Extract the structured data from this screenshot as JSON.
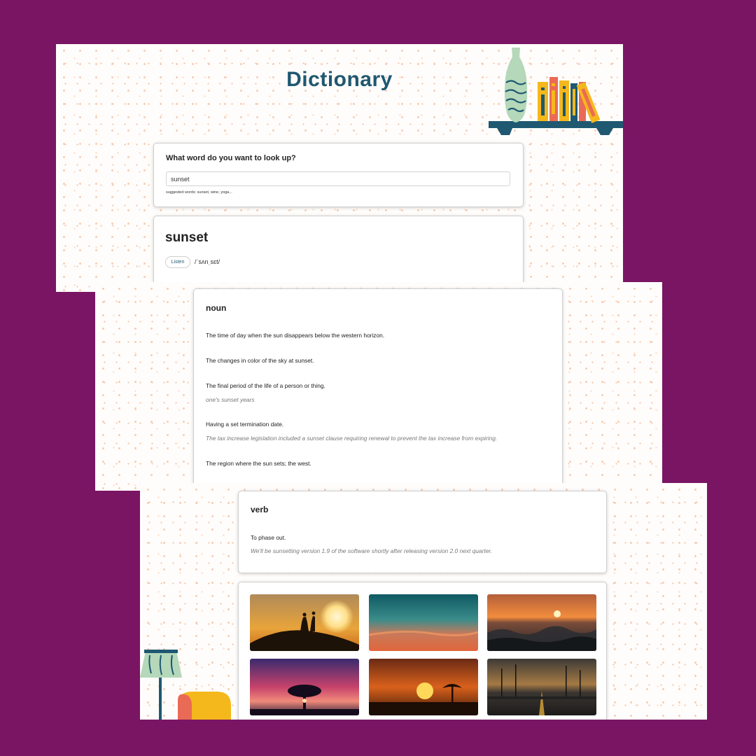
{
  "app": {
    "title": "Dictionary"
  },
  "search": {
    "label": "What word do you want to look up?",
    "value": "sunset",
    "suggestions": "suggested words: sunset, wine, yoga..."
  },
  "word": {
    "text": "sunset",
    "listen_label": "Listen",
    "phonetic": "/ˈsʌnˌsɛt/"
  },
  "meanings": [
    {
      "part_of_speech": "noun",
      "definitions": [
        {
          "definition": "The time of day when the sun disappears below the western horizon.",
          "example": ""
        },
        {
          "definition": "The changes in color of the sky at sunset.",
          "example": ""
        },
        {
          "definition": "The final period of the life of a person or thing.",
          "example": "one's sunset years"
        },
        {
          "definition": "Having a set termination date.",
          "example": "The tax increase legislation included a sunset clause requiring renewal to prevent the tax increase from expiring."
        },
        {
          "definition": "The region where the sun sets; the west.",
          "example": ""
        }
      ]
    },
    {
      "part_of_speech": "verb",
      "definitions": [
        {
          "definition": "To phase out.",
          "example": "We'll be sunsetting version 1.9 of the software shortly after releasing version 2.0 next quarter."
        }
      ]
    }
  ],
  "photos": [
    {
      "subject": "couple silhouette on hill at sunset"
    },
    {
      "subject": "teal and orange sky"
    },
    {
      "subject": "ocean waves at sunset"
    },
    {
      "subject": "lone tree under purple sky"
    },
    {
      "subject": "sun over savanna with tree"
    },
    {
      "subject": "palm tree lined road at dusk"
    }
  ],
  "colors": {
    "outer_background": "#7a1564",
    "title": "#1f5871",
    "speckle": "#f6cdb4",
    "vase": "#b4d8b9",
    "shelf": "#1f5871",
    "lamp": "#b4d8b9",
    "chair": "#f5b81c"
  }
}
